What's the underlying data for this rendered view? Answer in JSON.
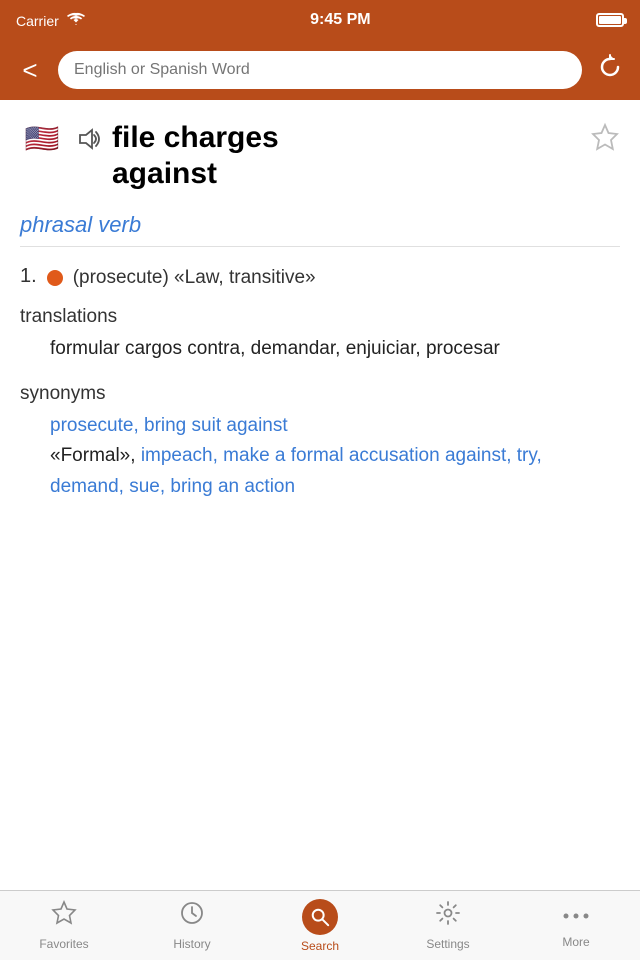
{
  "status": {
    "carrier": "Carrier",
    "time": "9:45 PM"
  },
  "nav": {
    "back_label": "<",
    "search_placeholder": "English or Spanish Word",
    "refresh_label": "↺"
  },
  "word": {
    "title_line1": "file charges",
    "title_line2": "against",
    "flag": "🇺🇸",
    "pos": "phrasal verb",
    "definition_number": "1.",
    "definition_tag": "(prosecute) «Law, transitive»",
    "translations_label": "translations",
    "translations_text": "formular cargos contra, demandar, enjuiciar, procesar",
    "synonyms_label": "synonyms",
    "synonyms_main": "prosecute, bring suit against",
    "synonyms_formal_marker": "«Formal»,",
    "synonyms_rest": "impeach, make a formal accusation against, try, demand, sue, bring an action"
  },
  "tabs": [
    {
      "id": "favorites",
      "label": "Favorites",
      "active": false
    },
    {
      "id": "history",
      "label": "History",
      "active": false
    },
    {
      "id": "search",
      "label": "Search",
      "active": true
    },
    {
      "id": "settings",
      "label": "Settings",
      "active": false
    },
    {
      "id": "more",
      "label": "More",
      "active": false
    }
  ]
}
